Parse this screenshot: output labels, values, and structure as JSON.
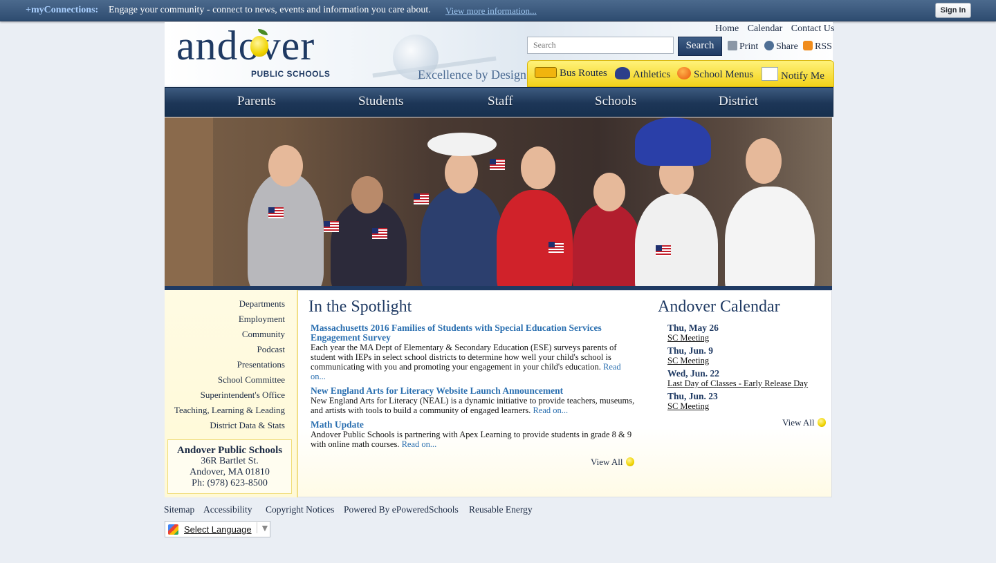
{
  "topbar": {
    "brand": "+myConnections:",
    "message": "Engage your community - connect to news, events and information you care about.",
    "more_link": "View more information...",
    "signin": "Sign In"
  },
  "header": {
    "logo_word": "andover",
    "logo_sub": "PUBLIC SCHOOLS",
    "tagline": "Excellence by Design",
    "utility_links": [
      "Home",
      "Calendar",
      "Contact Us"
    ],
    "search_placeholder": "Search",
    "search_button": "Search",
    "tools": [
      "Print",
      "Share",
      "RSS"
    ]
  },
  "quick_links": [
    "Bus Routes",
    "Athletics",
    "School Menus",
    "Notify Me"
  ],
  "nav": [
    "Parents",
    "Students",
    "Staff",
    "Schools",
    "District"
  ],
  "sidebar": {
    "links": [
      "Departments",
      "Employment",
      "Community",
      "Podcast",
      "Presentations",
      "School Committee",
      "Superintendent's Office",
      "Teaching, Learning & Leading",
      "District Data & Stats"
    ],
    "address": {
      "name": "Andover Public Schools",
      "street": "36R Bartlet St.",
      "city": "Andover, MA  01810",
      "phone": "Ph:  (978) 623-8500"
    }
  },
  "spotlight": {
    "title": "In the Spotlight",
    "stories": [
      {
        "title": "Massachusetts 2016 Families of Students with Special Education Services Engagement Survey",
        "body": "Each year the MA Dept of Elementary & Secondary Education (ESE) surveys parents of student with IEPs in select school districts to determine how well your child's school is communicating with you and promoting your engagement in your child's education.",
        "readon": "Read on..."
      },
      {
        "title": "New England Arts for Literacy Website Launch Announcement",
        "body": "New England Arts for Literacy (NEAL) is a dynamic initiative to provide teachers, museums, and artists with tools to build a community of engaged learners.",
        "readon": "Read on..."
      },
      {
        "title": "Math Update",
        "body": "Andover Public Schools is partnering with Apex Learning to provide students in grade 8 & 9 with online math courses.",
        "readon": "Read on..."
      }
    ],
    "view_all": "View All"
  },
  "calendar": {
    "title": "Andover Calendar",
    "events": [
      {
        "date": "Thu, May 26",
        "name": "SC Meeting"
      },
      {
        "date": "Thu, Jun. 9",
        "name": "SC Meeting"
      },
      {
        "date": "Wed, Jun. 22",
        "name": "Last Day of Classes - Early Release Day"
      },
      {
        "date": "Thu, Jun. 23",
        "name": "SC Meeting"
      }
    ],
    "view_all": "View All"
  },
  "footer": {
    "links": [
      "Sitemap",
      "Accessibility",
      "Copyright Notices",
      "Powered By ePoweredSchools",
      "Reusable Energy"
    ],
    "translate": "Select Language"
  }
}
